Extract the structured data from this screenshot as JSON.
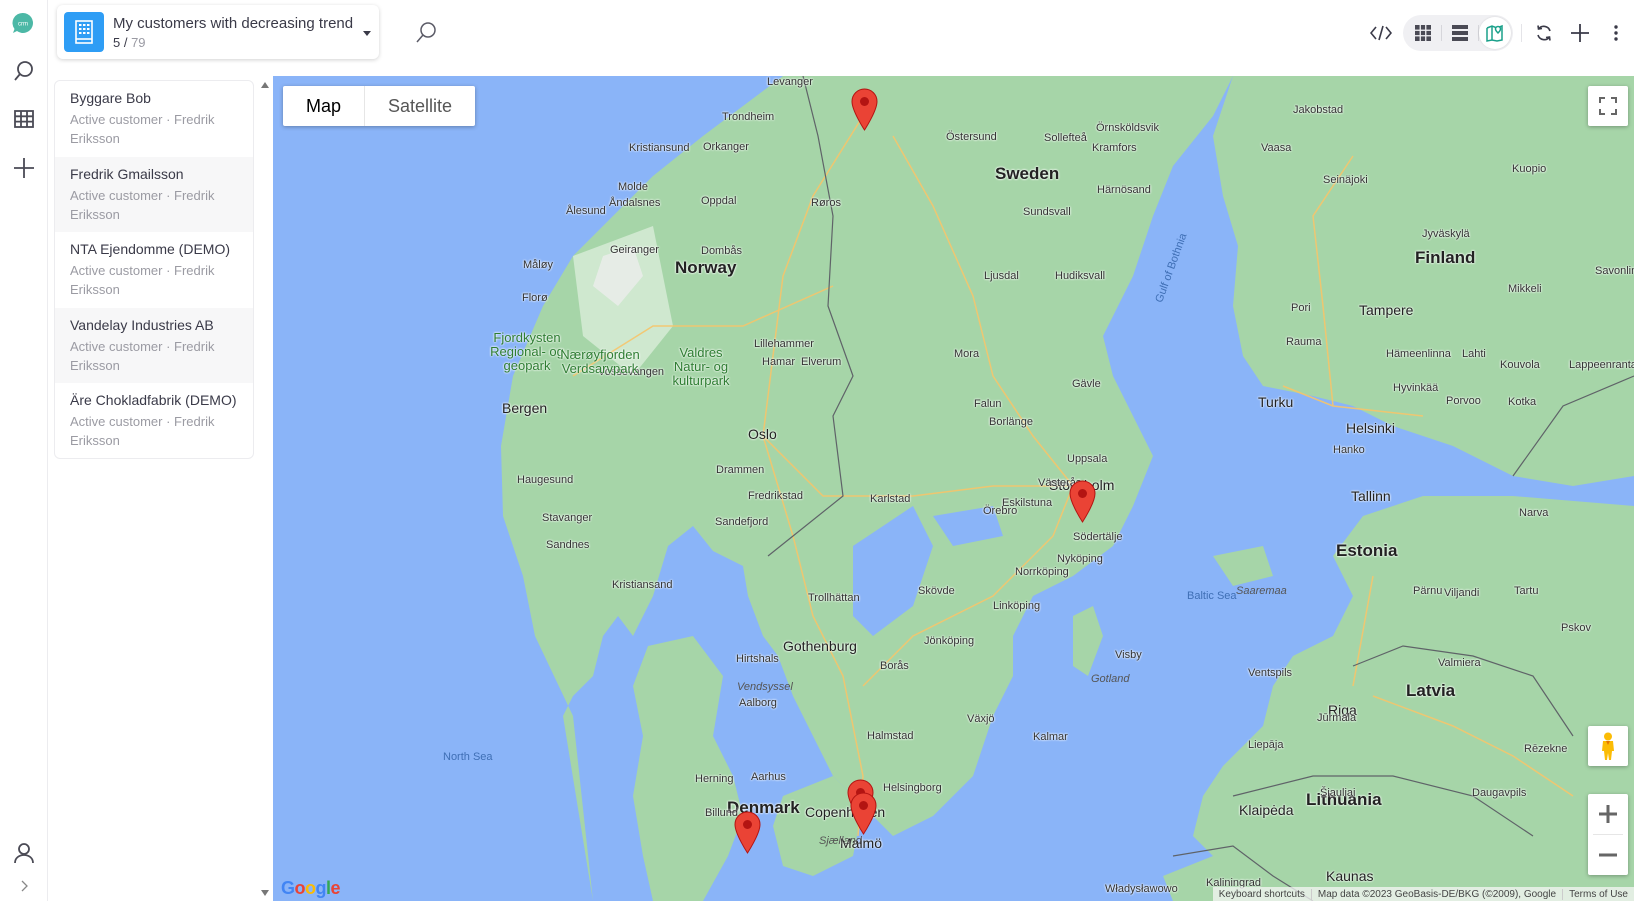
{
  "rail": {
    "logo_text": "crm",
    "logo_color": "#4cb8a6",
    "items": [
      {
        "name": "search",
        "icon": "search-icon"
      },
      {
        "name": "lists",
        "icon": "grid-icon"
      },
      {
        "name": "create",
        "icon": "plus-icon"
      }
    ],
    "bottom": [
      {
        "name": "account",
        "icon": "user-icon"
      },
      {
        "name": "expand",
        "icon": "chevron-right-icon"
      }
    ]
  },
  "header": {
    "list_title": "My customers with decreasing trend",
    "count_shown": "5",
    "count_separator": " / ",
    "count_total": "79",
    "badge_icon": "building-icon",
    "badge_color": "#2e9df5"
  },
  "toolbar": {
    "buttons": [
      "code-icon",
      "grid-view-icon",
      "list-view-icon",
      "map-view-icon",
      "refresh-icon",
      "plus-icon",
      "more-vertical-icon"
    ],
    "active_view": "map",
    "accent_color": "#1aa08a"
  },
  "customers": [
    {
      "name": "Byggare Bob",
      "status": "Active customer",
      "owner": "Fredrik Eriksson"
    },
    {
      "name": "Fredrik Gmailsson",
      "status": "Active customer",
      "owner": "Fredrik Eriksson"
    },
    {
      "name": "NTA Ejendomme (DEMO)",
      "status": "Active customer",
      "owner": "Fredrik Eriksson"
    },
    {
      "name": "Vandelay Industries AB",
      "status": "Active customer",
      "owner": "Fredrik Eriksson"
    },
    {
      "name": "Äre Chokladfabrik (DEMO)",
      "status": "Active customer",
      "owner": "Fredrik Eriksson"
    }
  ],
  "customer_sublines": [
    "Active customer · Fredrik Eriksson",
    "Active customer · Fredrik Eriksson",
    "Active customer · Fredrik Eriksson",
    "Active customer · Fredrik Eriksson",
    "Active customer · Fredrik Eriksson"
  ],
  "map": {
    "type_options": [
      "Map",
      "Satellite"
    ],
    "selected_type": "Map",
    "attribution": {
      "shortcuts": "Keyboard shortcuts",
      "data": "Map data ©2023 GeoBasis-DE/BKG (©2009), Google",
      "terms": "Terms of Use"
    },
    "logo": "Google",
    "countries": [
      "Sweden",
      "Norway",
      "Finland",
      "Estonia",
      "Latvia",
      "Lithuania",
      "Denmark"
    ],
    "labels": {
      "cities_big": [
        "Stockholm",
        "Oslo",
        "Bergen",
        "Helsinki",
        "Gothenburg",
        "Copenhagen",
        "Malmö",
        "Tallinn",
        "Riga",
        "Kaunas",
        "Tampere",
        "Turku",
        "Klaipėda"
      ],
      "cities": [
        "Levanger",
        "Trondheim",
        "Kristiansund",
        "Orkanger",
        "Molde",
        "Åndalsnes",
        "Ålesund",
        "Oppdal",
        "Røros",
        "Geiranger",
        "Dombås",
        "Måløy",
        "Florø",
        "Lillehammer",
        "Hamar",
        "Elverum",
        "Drammen",
        "Fredrikstad",
        "Sandefjord",
        "Haugesund",
        "Stavanger",
        "Sandnes",
        "Kristiansand",
        "Östersund",
        "Sollefteå",
        "Örnsköldsvik",
        "Kramfors",
        "Härnösand",
        "Sundsvall",
        "Ljusdal",
        "Hudiksvall",
        "Mora",
        "Falun",
        "Borlänge",
        "Gävle",
        "Uppsala",
        "Västerås",
        "Eskilstuna",
        "Örebro",
        "Karlstad",
        "Södertälje",
        "Nyköping",
        "Norrköping",
        "Linköping",
        "Skövde",
        "Trollhättan",
        "Jönköping",
        "Borås",
        "Växjö",
        "Kalmar",
        "Halmstad",
        "Helsingborg",
        "Visby",
        "Hirtshals",
        "Aalborg",
        "Herning",
        "Aarhus",
        "Billund",
        "Vaasa",
        "Seinäjoki",
        "Kuopio",
        "Jyväskylä",
        "Mikkeli",
        "Savonlinna",
        "Pori",
        "Rauma",
        "Hämeenlinna",
        "Lahti",
        "Kouvola",
        "Lappeenranta",
        "Hyvinkää",
        "Porvoo",
        "Kotka",
        "Hanko",
        "Jakobstad",
        "Narva",
        "Pärnu",
        "Viljandi",
        "Tartu",
        "Pskov",
        "Valmiera",
        "Ventspils",
        "Jūrmala",
        "Liepāja",
        "Rēzekne",
        "Daugavpils",
        "Šiauliai",
        "Kaliningrad",
        "Władysławowo",
        "Vossevangen"
      ],
      "water": [
        "North Sea",
        "Baltic Sea",
        "Gulf of Bothnia",
        "Gotland",
        "Saaremaa",
        "Vendsyssel",
        "Sjælland"
      ],
      "parks": [
        "Fjordkysten Regional- og geopark",
        "Nærøyfjorden Verdsarvpark",
        "Valdres Natur- og kulturpark"
      ]
    },
    "markers": [
      {
        "label": "Åre",
        "color": "#ea4335"
      },
      {
        "label": "Stockholm",
        "color": "#ea4335"
      },
      {
        "label": "Helsingborg",
        "color": "#ea4335"
      },
      {
        "label": "Malmö",
        "color": "#ea4335"
      },
      {
        "label": "Denmark",
        "color": "#ea4335"
      }
    ]
  }
}
